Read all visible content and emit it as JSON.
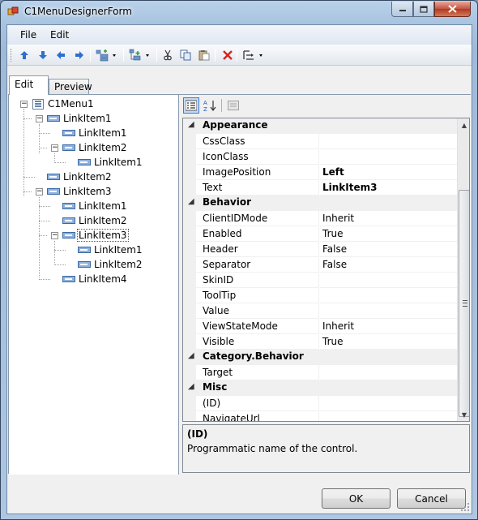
{
  "window": {
    "title": "C1MenuDesignerForm"
  },
  "menubar": {
    "items": [
      {
        "label": "File"
      },
      {
        "label": "Edit"
      }
    ]
  },
  "toolbar": {
    "tools": [
      {
        "icon": "move-up-icon"
      },
      {
        "icon": "move-down-icon"
      },
      {
        "icon": "move-left-icon"
      },
      {
        "icon": "move-right-icon"
      },
      {
        "icon": "insert-item-icon"
      },
      {
        "icon": "add-child-icon"
      },
      {
        "icon": "cut-icon"
      },
      {
        "icon": "copy-icon"
      },
      {
        "icon": "paste-icon"
      },
      {
        "icon": "delete-icon"
      },
      {
        "icon": "change-type-icon"
      }
    ]
  },
  "tabs": [
    {
      "label": "Edit"
    },
    {
      "label": "Preview"
    }
  ],
  "tree": {
    "root": "C1Menu1",
    "nodes": [
      {
        "label": "LinkItem1"
      },
      {
        "label": "LinkItem1"
      },
      {
        "label": "LinkItem2"
      },
      {
        "label": "LinkItem1"
      },
      {
        "label": "LinkItem2"
      },
      {
        "label": "LinkItem3"
      },
      {
        "label": "LinkItem1"
      },
      {
        "label": "LinkItem2"
      },
      {
        "label": "LinkItem3"
      },
      {
        "label": "LinkItem1"
      },
      {
        "label": "LinkItem2"
      },
      {
        "label": "LinkItem4"
      }
    ]
  },
  "properties": {
    "categories": [
      {
        "label": "Appearance",
        "rows": [
          {
            "name": "CssClass",
            "value": ""
          },
          {
            "name": "IconClass",
            "value": ""
          },
          {
            "name": "ImagePosition",
            "value": "Left"
          },
          {
            "name": "Text",
            "value": "LinkItem3"
          }
        ]
      },
      {
        "label": "Behavior",
        "rows": [
          {
            "name": "ClientIDMode",
            "value": "Inherit"
          },
          {
            "name": "Enabled",
            "value": "True"
          },
          {
            "name": "Header",
            "value": "False"
          },
          {
            "name": "Separator",
            "value": "False"
          },
          {
            "name": "SkinID",
            "value": ""
          },
          {
            "name": "ToolTip",
            "value": ""
          },
          {
            "name": "Value",
            "value": ""
          },
          {
            "name": "ViewStateMode",
            "value": "Inherit"
          },
          {
            "name": "Visible",
            "value": "True"
          }
        ]
      },
      {
        "label": "Category.Behavior",
        "rows": [
          {
            "name": "Target",
            "value": ""
          }
        ]
      },
      {
        "label": "Misc",
        "rows": [
          {
            "name": "(ID)",
            "value": ""
          },
          {
            "name": "NavigateUrl",
            "value": ""
          }
        ]
      }
    ],
    "help": {
      "title": "(ID)",
      "description": "Programmatic name of the control."
    }
  },
  "buttons": {
    "ok": "OK",
    "cancel": "Cancel"
  }
}
